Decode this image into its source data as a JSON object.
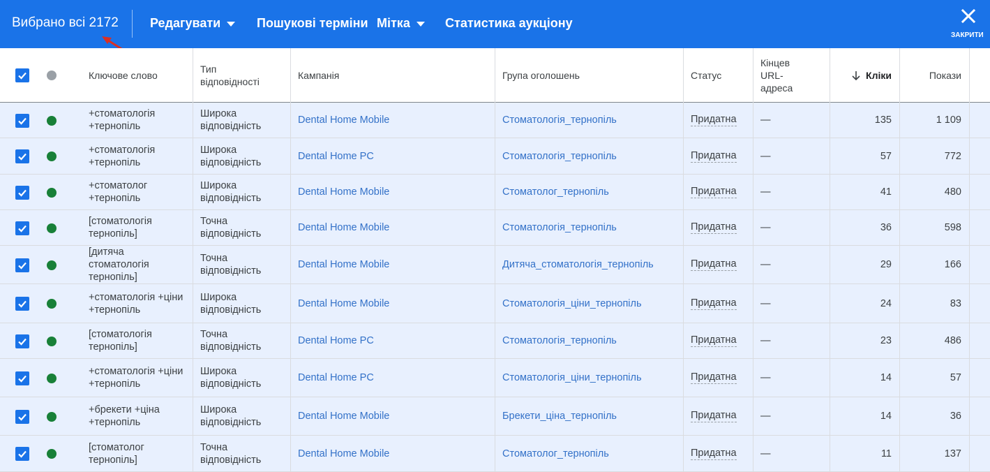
{
  "topbar": {
    "selected_all": "Вибрано всі 2172",
    "menu_edit": "Редагувати",
    "menu_search_terms": "Пошукові терміни",
    "menu_label": "Мітка",
    "menu_auction": "Статистика аукціону",
    "close_label": "ЗАКРИТИ"
  },
  "colors": {
    "topbar": "#1a73e8",
    "row_selected": "#e8f0fe",
    "status_enabled": "#188038",
    "header_dot": "#9aa0a6",
    "link": "#3371c8",
    "annotation_arrow": "#d93025"
  },
  "table": {
    "headers": {
      "keyword": "Ключове слово",
      "match_type": "Тип відповідності",
      "campaign": "Кампанія",
      "ad_group": "Група оголошень",
      "status": "Статус",
      "final_url": "Кінцев URL-адреса",
      "clicks": "Кліки",
      "impressions": "Покази"
    },
    "rows": [
      {
        "keyword": "+стоматологія +тернопіль",
        "match": "Широка відповідність",
        "campaign": "Dental Home Mobile",
        "ad_group": "Стоматологія_тернопіль",
        "status": "Придатна",
        "url": "—",
        "clicks": "135",
        "impressions": "1 109"
      },
      {
        "keyword": "+стоматологія +тернопіль",
        "match": "Широка відповідність",
        "campaign": "Dental Home PC",
        "ad_group": "Стоматологія_тернопіль",
        "status": "Придатна",
        "url": "—",
        "clicks": "57",
        "impressions": "772"
      },
      {
        "keyword": "+стоматолог +тернопіль",
        "match": "Широка відповідність",
        "campaign": "Dental Home Mobile",
        "ad_group": "Стоматолог_тернопіль",
        "status": "Придатна",
        "url": "—",
        "clicks": "41",
        "impressions": "480"
      },
      {
        "keyword": "[стоматологія тернопіль]",
        "match": "Точна відповідність",
        "campaign": "Dental Home Mobile",
        "ad_group": "Стоматологія_тернопіль",
        "status": "Придатна",
        "url": "—",
        "clicks": "36",
        "impressions": "598"
      },
      {
        "keyword": "[дитяча стоматологія тернопіль]",
        "match": "Точна відповідність",
        "campaign": "Dental Home Mobile",
        "ad_group": "Дитяча_стоматологія_тернопіль",
        "status": "Придатна",
        "url": "—",
        "clicks": "29",
        "impressions": "166"
      },
      {
        "keyword": "+стоматологія +ціни +тернопіль",
        "match": "Широка відповідність",
        "campaign": "Dental Home Mobile",
        "ad_group": "Стоматологія_ціни_тернопіль",
        "status": "Придатна",
        "url": "—",
        "clicks": "24",
        "impressions": "83"
      },
      {
        "keyword": "[стоматологія тернопіль]",
        "match": "Точна відповідність",
        "campaign": "Dental Home PC",
        "ad_group": "Стоматологія_тернопіль",
        "status": "Придатна",
        "url": "—",
        "clicks": "23",
        "impressions": "486"
      },
      {
        "keyword": "+стоматологія +ціни +тернопіль",
        "match": "Широка відповідність",
        "campaign": "Dental Home PC",
        "ad_group": "Стоматологія_ціни_тернопіль",
        "status": "Придатна",
        "url": "—",
        "clicks": "14",
        "impressions": "57"
      },
      {
        "keyword": "+брекети +ціна +тернопіль",
        "match": "Широка відповідність",
        "campaign": "Dental Home Mobile",
        "ad_group": "Брекети_ціна_тернопіль",
        "status": "Придатна",
        "url": "—",
        "clicks": "14",
        "impressions": "36"
      },
      {
        "keyword": "[стоматолог тернопіль]",
        "match": "Точна відповідність",
        "campaign": "Dental Home Mobile",
        "ad_group": "Стоматолог_тернопіль",
        "status": "Придатна",
        "url": "—",
        "clicks": "11",
        "impressions": "137"
      }
    ]
  }
}
